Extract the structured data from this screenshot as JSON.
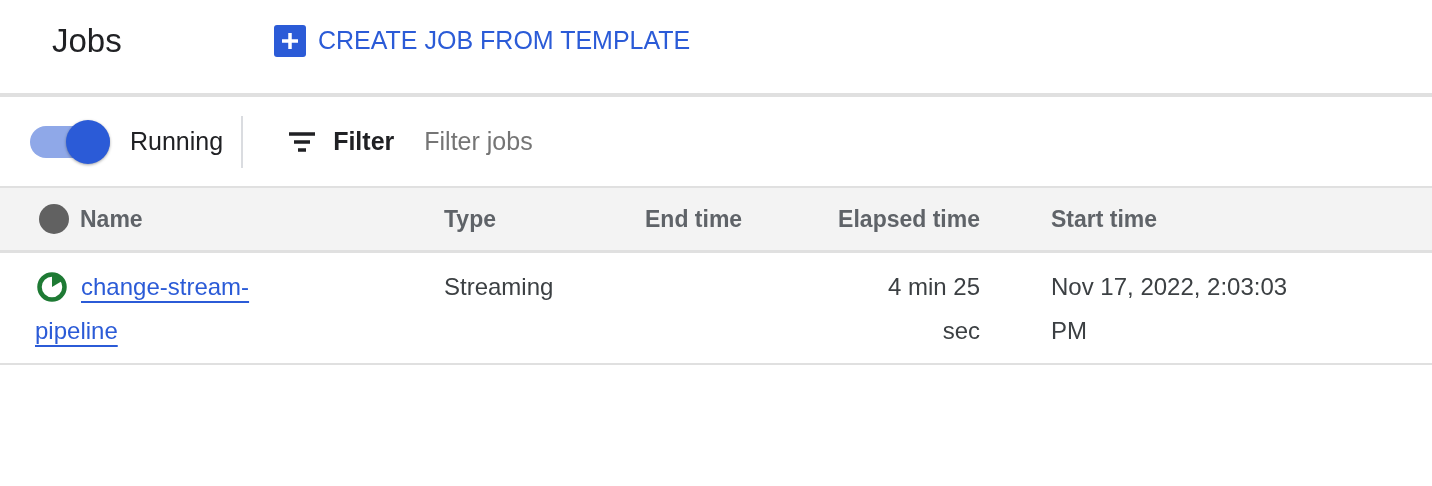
{
  "header": {
    "title": "Jobs",
    "create_button": "CREATE JOB FROM TEMPLATE"
  },
  "toolbar": {
    "toggle": {
      "label": "Running",
      "on": true
    },
    "filter_label": "Filter",
    "filter_placeholder": "Filter jobs"
  },
  "table": {
    "columns": [
      "Name",
      "Type",
      "End time",
      "Elapsed time",
      "Start time"
    ],
    "rows": [
      {
        "name": "change-stream-pipeline",
        "type": "Streaming",
        "end_time": "",
        "elapsed_time": "4 min 25 sec",
        "start_time": "Nov 17, 2022, 2:03:03 PM"
      }
    ]
  }
}
